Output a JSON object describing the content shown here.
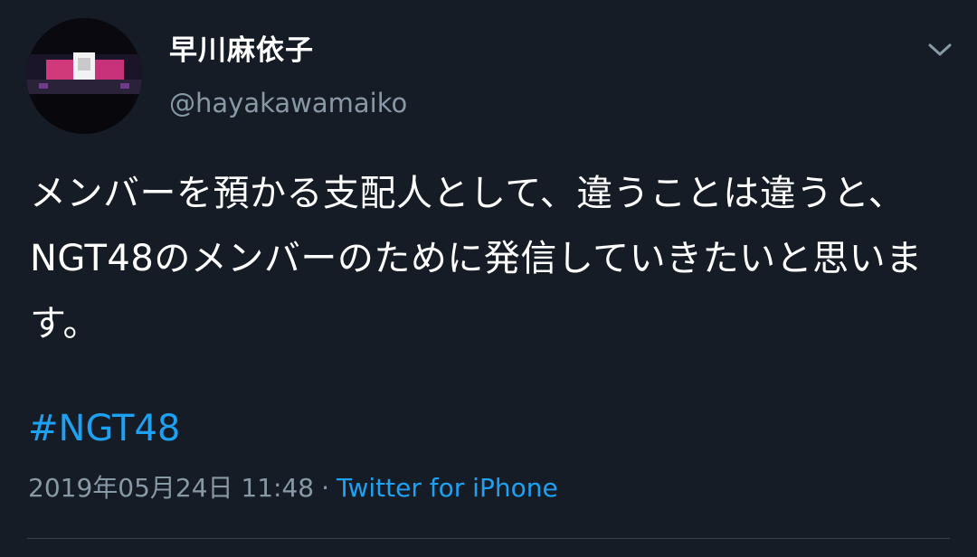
{
  "user": {
    "display_name": "早川麻依子",
    "handle": "@hayakawamaiko",
    "avatar_icon": "stage-photo-avatar"
  },
  "menu": {
    "icon": "chevron-down-icon"
  },
  "tweet": {
    "text": "メンバーを預かる支配人として、違うことは違うと、NGT48のメンバーのために発信していきたいと思います。",
    "hashtag": "#NGT48",
    "timestamp": "2019年05月24日 11:48",
    "separator": "·",
    "source": "Twitter for iPhone"
  },
  "colors": {
    "background": "#151c26",
    "text": "#ffffff",
    "muted": "#8899a6",
    "link": "#1da1f2"
  }
}
